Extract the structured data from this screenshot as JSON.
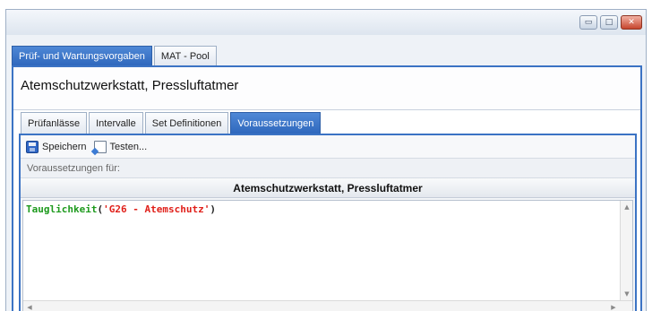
{
  "window": {
    "buttons": {
      "minimize": "▭",
      "maximize": "□",
      "close": "✕"
    }
  },
  "outer_tabs": [
    {
      "label": "Prüf- und Wartungsvorgaben",
      "active": true
    },
    {
      "label": "MAT - Pool",
      "active": false
    }
  ],
  "record_title": "Atemschutzwerkstatt, Pressluftatmer",
  "inner_tabs": [
    {
      "label": "Prüfanlässe",
      "active": false
    },
    {
      "label": "Intervalle",
      "active": false
    },
    {
      "label": "Set Definitionen",
      "active": false
    },
    {
      "label": "Voraussetzungen",
      "active": true
    }
  ],
  "toolbar": {
    "save_label": "Speichern",
    "save_icon": "save-icon",
    "test_label": "Testen...",
    "test_icon": "test-icon"
  },
  "prerequisites_label": "Voraussetzungen für:",
  "section_header": "Atemschutzwerkstatt, Pressluftatmer",
  "editor": {
    "function_name": "Tauglichkeit",
    "open_paren": "(",
    "string_literal": "'G26 - Atemschutz'",
    "close_paren": ")"
  },
  "colors": {
    "accent": "#3b73c4",
    "function": "#1d9a1d",
    "string": "#e0201a"
  }
}
